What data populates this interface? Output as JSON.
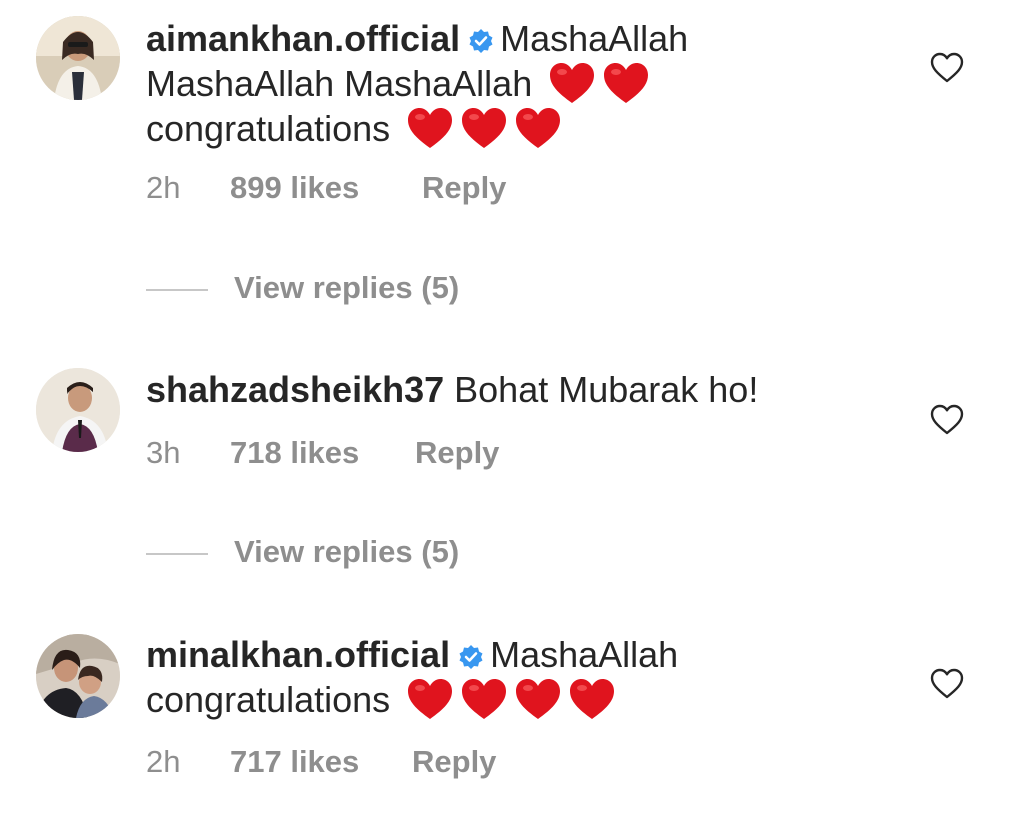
{
  "comments": [
    {
      "username": "aimankhan.official",
      "verified": true,
      "text_line1": "MashaAllah",
      "text_line2": "MashaAllah MashaAllah",
      "text_line3": "congratulations",
      "hearts_line2": 2,
      "hearts_line3": 3,
      "time": "2h",
      "likes": "899 likes",
      "reply": "Reply",
      "view_replies": "View replies (5)"
    },
    {
      "username": "shahzadsheikh37",
      "verified": false,
      "text_line1": "Bohat Mubarak ho!",
      "time": "3h",
      "likes": "718 likes",
      "reply": "Reply",
      "view_replies": "View replies (5)"
    },
    {
      "username": "minalkhan.official",
      "verified": true,
      "text_line1": "MashaAllah",
      "text_line2": "congratulations",
      "hearts_line2": 4,
      "time": "2h",
      "likes": "717 likes",
      "reply": "Reply"
    }
  ],
  "colors": {
    "text": "#262626",
    "secondary": "#8e8e8e",
    "verified_blue": "#3897f0",
    "heart_red": "#e0141e"
  },
  "icons": {
    "verified": "verified-badge-icon",
    "like": "heart-outline-icon",
    "emoji": "red-heart-emoji"
  }
}
